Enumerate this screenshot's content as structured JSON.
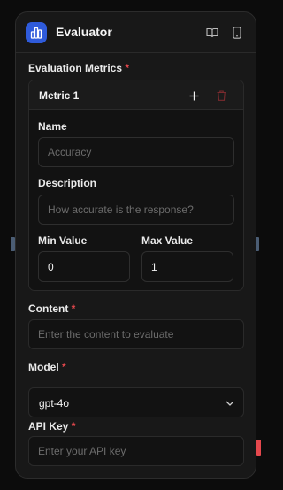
{
  "node": {
    "title": "Evaluator",
    "header_icons": [
      "docs-book-icon",
      "mobile-preview-icon"
    ]
  },
  "metrics_section": {
    "label": "Evaluation Metrics",
    "required_mark": "*",
    "metric": {
      "title": "Metric 1",
      "name_label": "Name",
      "name_placeholder": "Accuracy",
      "description_label": "Description",
      "description_placeholder": "How accurate is the response?",
      "min_label": "Min Value",
      "min_value": "0",
      "max_label": "Max Value",
      "max_value": "1"
    }
  },
  "content": {
    "label": "Content",
    "required_mark": "*",
    "placeholder": "Enter the content to evaluate"
  },
  "model": {
    "label": "Model",
    "required_mark": "*",
    "selected": "gpt-4o"
  },
  "api_key": {
    "label": "API Key",
    "required_mark": "*",
    "placeholder": "Enter your API key"
  },
  "colors": {
    "accent": "#2f5bdb",
    "required": "#e5484d",
    "handle": "#4b5d74"
  }
}
